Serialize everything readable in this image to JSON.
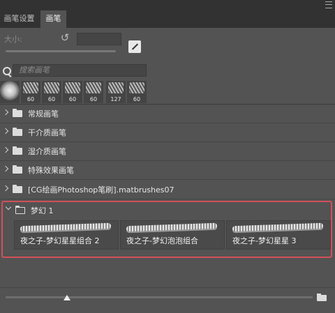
{
  "tabs": [
    {
      "label": "画笔设置",
      "active": false
    },
    {
      "label": "画笔",
      "active": true
    }
  ],
  "size": {
    "label": "大小:",
    "value": ""
  },
  "search": {
    "placeholder": "搜索画笔"
  },
  "presets": [
    {
      "size": "",
      "kind": "soft-round"
    },
    {
      "size": "60",
      "kind": "textured"
    },
    {
      "size": "60",
      "kind": "textured"
    },
    {
      "size": "60",
      "kind": "textured"
    },
    {
      "size": "60",
      "kind": "textured"
    },
    {
      "size": "127",
      "kind": "textured"
    },
    {
      "size": "60",
      "kind": "textured"
    }
  ],
  "groups": [
    {
      "label": "常规画笔",
      "expanded": false
    },
    {
      "label": "干介质画笔",
      "expanded": false
    },
    {
      "label": "湿介质画笔",
      "expanded": false
    },
    {
      "label": "特殊效果画笔",
      "expanded": false
    },
    {
      "label": "[CG绘画Photoshop笔刷].matbrushes07",
      "expanded": false
    },
    {
      "label": "梦幻 1",
      "expanded": true
    }
  ],
  "brushes": [
    {
      "name": "夜之子-梦幻星星组合 2"
    },
    {
      "name": "夜之子-梦幻泡泡组合"
    },
    {
      "name": "夜之子-梦幻星星 3"
    }
  ],
  "preview_slider": {
    "level": 0.2
  },
  "colors": {
    "panel": "#535353",
    "tabbar": "#323232",
    "highlight": "#d2505a"
  }
}
